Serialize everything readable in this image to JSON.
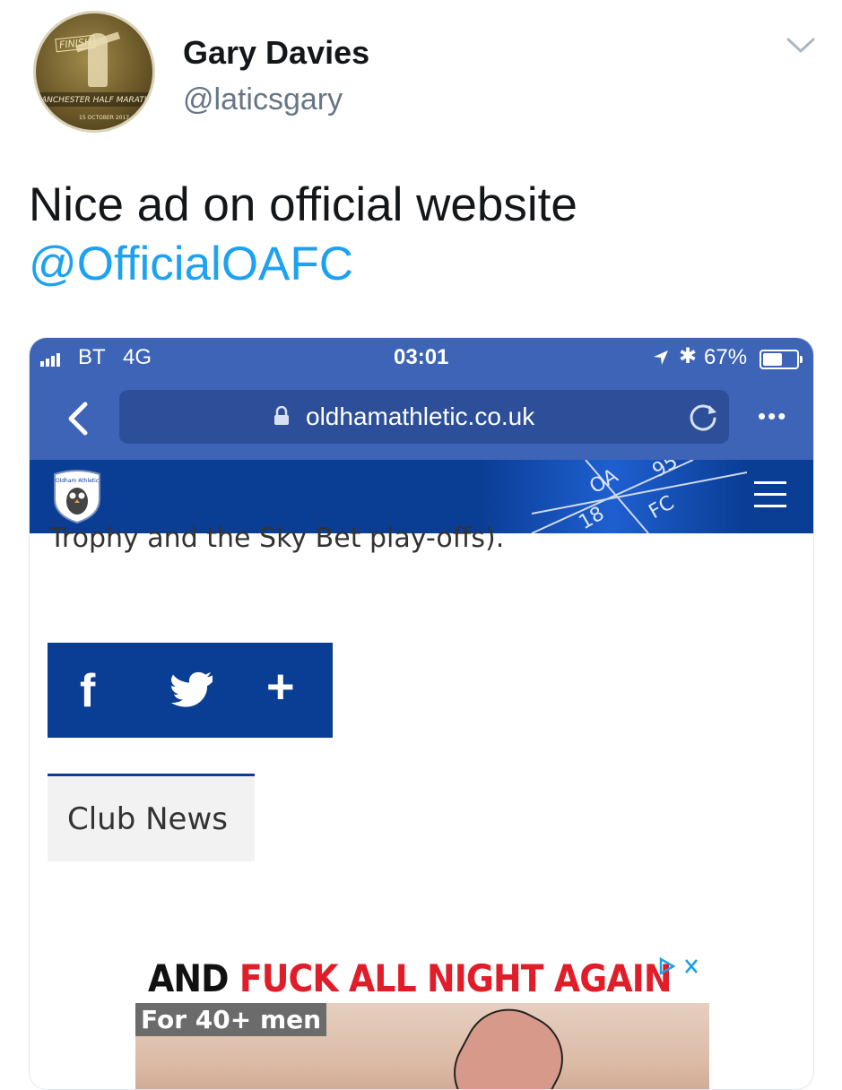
{
  "tweet": {
    "display_name": "Gary Davies",
    "handle": "@laticsgary",
    "text": "Nice ad on official website",
    "mention": "@OfficialOAFC",
    "avatar": {
      "ring_text": "ANCHESTER HALF MARATH",
      "banner_text": "FINISH",
      "date_text": "15 OCTOBER 2017"
    }
  },
  "phone": {
    "status_bar": {
      "carrier": "BT",
      "network": "4G",
      "time": "03:01",
      "battery": "67%",
      "battery_level": 0.67
    },
    "browser": {
      "url": "oldhamathletic.co.uk"
    },
    "site": {
      "crest_text": "Oldham Athletic",
      "header_art": {
        "top_left": "OA",
        "top_right": "95",
        "bottom_left": "18",
        "bottom_right": "FC"
      },
      "content_line": "Trophy and the Sky Bet play-offs).",
      "share": {
        "facebook": "f",
        "plus": "+"
      },
      "news_tab": "Club News",
      "ad": {
        "headline_a": "AND ",
        "headline_b": "FUCK ALL NIGHT AGAIN",
        "tag": "For 40+ men"
      }
    }
  },
  "colors": {
    "link": "#1da1f2",
    "browser_chrome": "#3d64b6",
    "club_blue": "#0a3d94",
    "ad_red": "#e01e2a"
  },
  "icons": [
    "chevron-down-icon",
    "signal-icon",
    "location-arrow-icon",
    "bluetooth-icon",
    "battery-icon",
    "back-icon",
    "lock-icon",
    "reload-icon",
    "more-icon",
    "crest-icon",
    "menu-icon",
    "facebook-icon",
    "twitter-icon",
    "plus-icon",
    "adchoices-icon",
    "close-icon"
  ]
}
